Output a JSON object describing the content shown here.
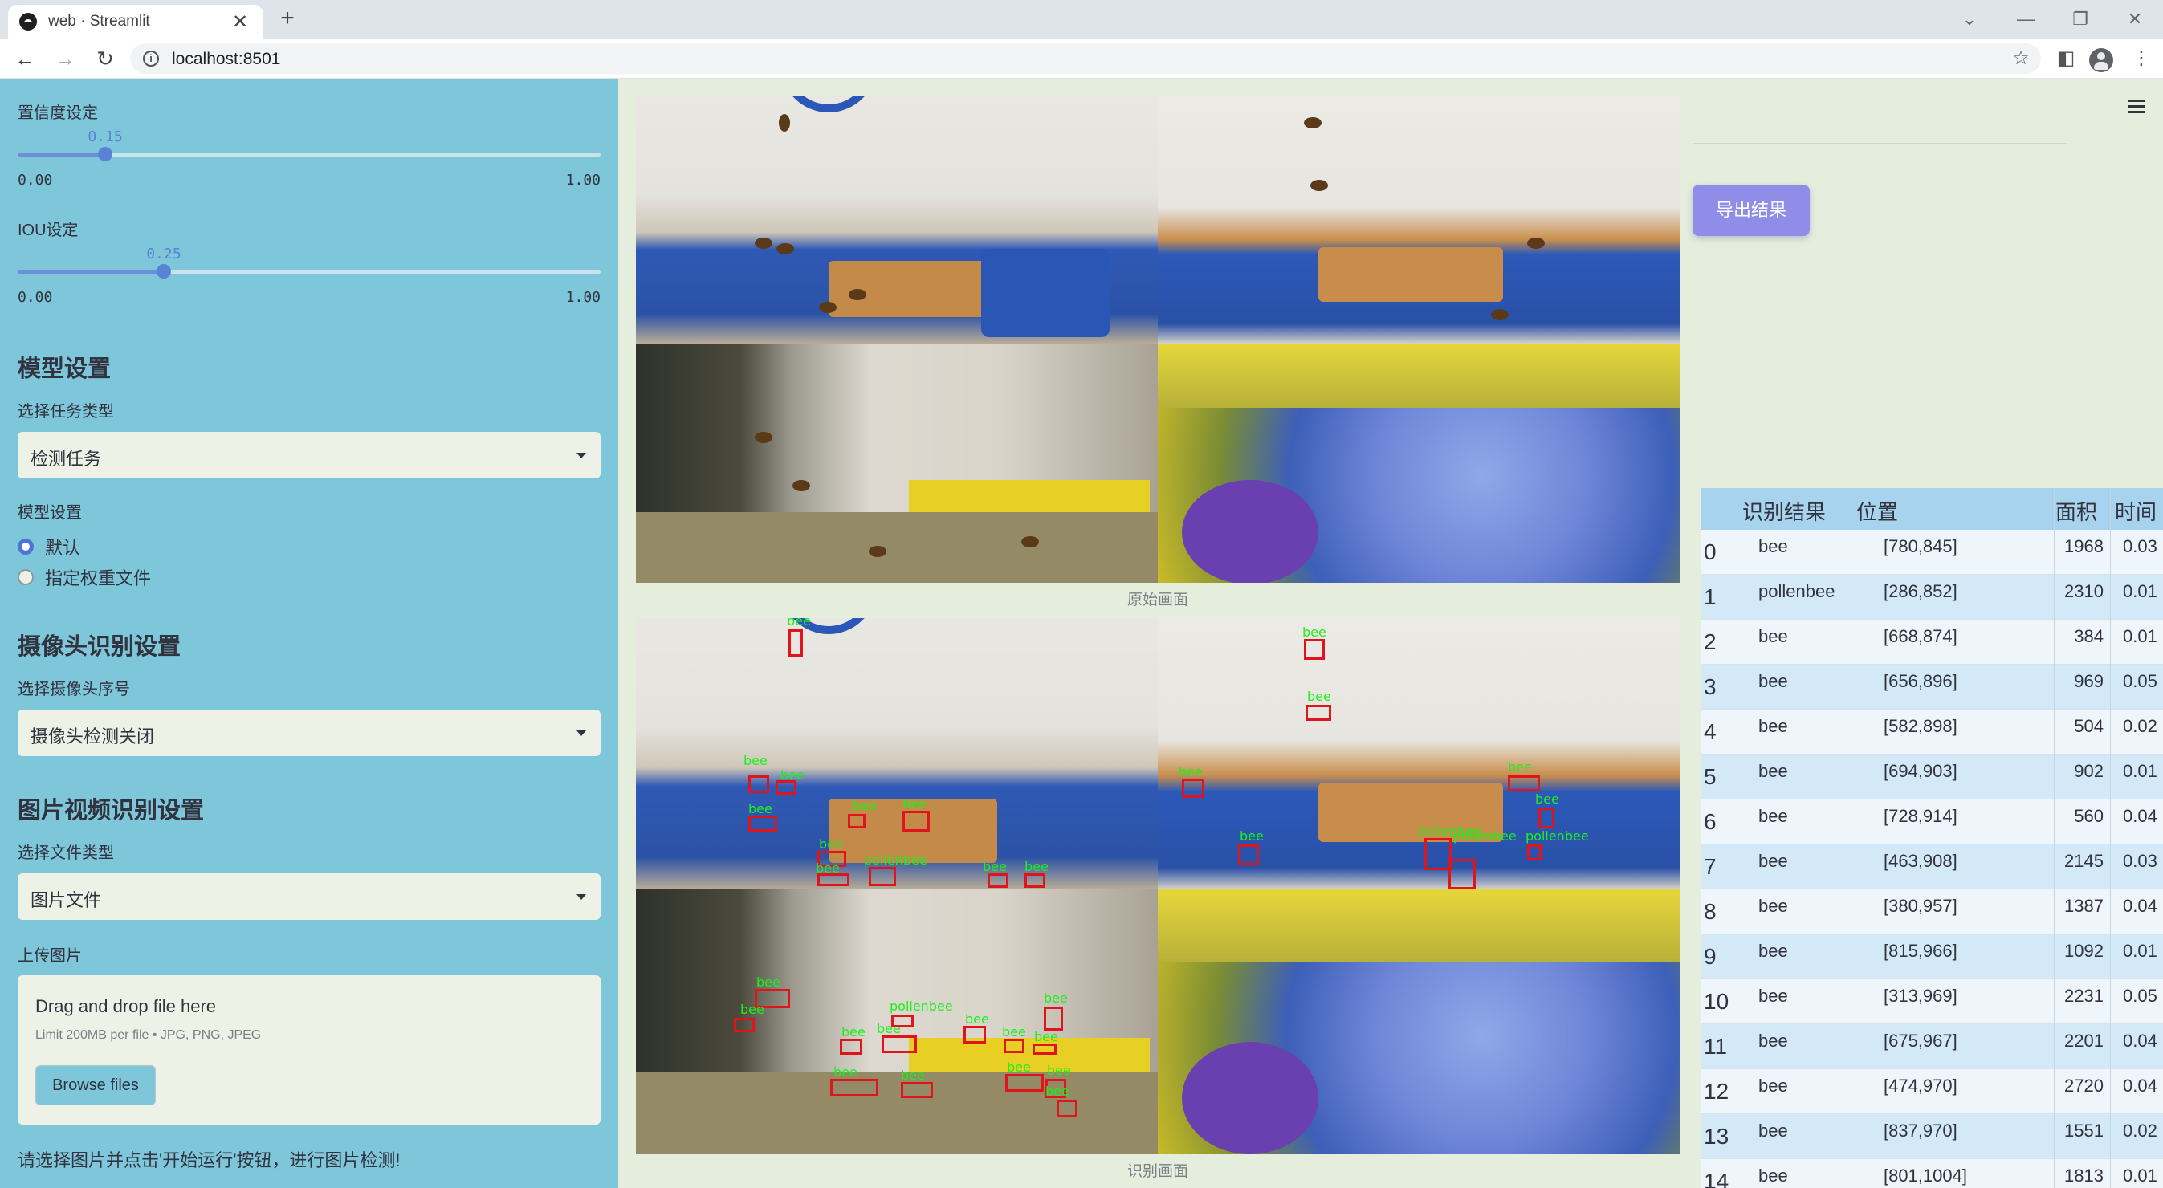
{
  "browser": {
    "tab_title": "web · Streamlit",
    "close_glyph": "✕",
    "new_tab_glyph": "+",
    "url": "localhost:8501"
  },
  "sidebar": {
    "confidence": {
      "label": "置信度设定",
      "value": "0.15",
      "fraction": 0.15,
      "min": "0.00",
      "max": "1.00"
    },
    "iou": {
      "label": "IOU设定",
      "value": "0.25",
      "fraction": 0.25,
      "min": "0.00",
      "max": "1.00"
    },
    "model_heading": "模型设置",
    "task_label": "选择任务类型",
    "task_value": "检测任务",
    "model_label": "模型设置",
    "model_options": [
      "默认",
      "指定权重文件"
    ],
    "camera_heading": "摄像头识别设置",
    "camera_label": "选择摄像头序号",
    "camera_value": "摄像头检测关闭",
    "media_heading": "图片视频识别设置",
    "filetype_label": "选择文件类型",
    "filetype_value": "图片文件",
    "upload_label": "上传图片",
    "upload_title": "Drag and drop file here",
    "upload_limit": "Limit 200MB per file • JPG, PNG, JPEG",
    "browse_label": "Browse files",
    "hint": "请选择图片并点击'开始运行'按钮，进行图片检测!"
  },
  "main": {
    "original_caption": "原始画面",
    "result_caption": "识别画面",
    "export_label": "导出结果",
    "detection_labels": [
      "bee",
      "pollenbee"
    ],
    "table": {
      "headers": [
        "识别结果",
        "位置",
        "面积",
        "时间"
      ],
      "rows": [
        {
          "idx": "0",
          "cls": "bee",
          "pos": "[780,845]",
          "area": "1968",
          "time": "0.03"
        },
        {
          "idx": "1",
          "cls": "pollenbee",
          "pos": "[286,852]",
          "area": "2310",
          "time": "0.01"
        },
        {
          "idx": "2",
          "cls": "bee",
          "pos": "[668,874]",
          "area": "384",
          "time": "0.01"
        },
        {
          "idx": "3",
          "cls": "bee",
          "pos": "[656,896]",
          "area": "969",
          "time": "0.05"
        },
        {
          "idx": "4",
          "cls": "bee",
          "pos": "[582,898]",
          "area": "504",
          "time": "0.02"
        },
        {
          "idx": "5",
          "cls": "bee",
          "pos": "[694,903]",
          "area": "902",
          "time": "0.01"
        },
        {
          "idx": "6",
          "cls": "bee",
          "pos": "[728,914]",
          "area": "560",
          "time": "0.04"
        },
        {
          "idx": "7",
          "cls": "bee",
          "pos": "[463,908]",
          "area": "2145",
          "time": "0.03"
        },
        {
          "idx": "8",
          "cls": "bee",
          "pos": "[380,957]",
          "area": "1387",
          "time": "0.04"
        },
        {
          "idx": "9",
          "cls": "bee",
          "pos": "[815,966]",
          "area": "1092",
          "time": "0.01"
        },
        {
          "idx": "10",
          "cls": "bee",
          "pos": "[313,969]",
          "area": "2231",
          "time": "0.05"
        },
        {
          "idx": "11",
          "cls": "bee",
          "pos": "[675,967]",
          "area": "2201",
          "time": "0.04"
        },
        {
          "idx": "12",
          "cls": "bee",
          "pos": "[474,970]",
          "area": "2720",
          "time": "0.04"
        },
        {
          "idx": "13",
          "cls": "bee",
          "pos": "[837,970]",
          "area": "1551",
          "time": "0.02"
        },
        {
          "idx": "14",
          "cls": "bee",
          "pos": "[801,1004]",
          "area": "1813",
          "time": "0.01"
        }
      ]
    }
  },
  "icons": [
    "streamlit-favicon",
    "back-arrow-icon",
    "forward-arrow-icon",
    "reload-icon",
    "info-icon",
    "bookmark-star-icon",
    "side-panel-icon",
    "profile-avatar-icon",
    "kebab-menu-icon",
    "hamburger-menu-icon",
    "chevron-down-icon"
  ],
  "colors": {
    "sidebar_bg": "#7ec6d9",
    "main_bg": "#e5eedd",
    "accent": "#5a82d6",
    "export_button": "#8f8de8",
    "box": "#e0141b",
    "box_label": "#1cf01c"
  }
}
